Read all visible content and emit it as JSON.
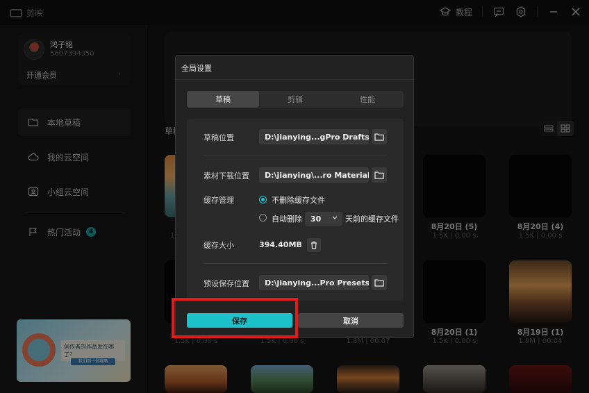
{
  "app": {
    "logo_text": "剪映",
    "help_label": "教程"
  },
  "user": {
    "name": "鸿子铭",
    "id": "5607394350",
    "vip_label": "开通会员",
    "vip_arrow": "›"
  },
  "sidebar": {
    "items": [
      {
        "label": "本地草稿",
        "icon": "folder-icon",
        "active": true
      },
      {
        "label": "我的云空间",
        "icon": "cloud-icon",
        "active": false
      },
      {
        "label": "小组云空间",
        "icon": "group-space-icon",
        "active": false
      },
      {
        "label": "热门活动",
        "icon": "flag-icon",
        "active": false,
        "badge": "4"
      }
    ],
    "banner": {
      "text": "创作者的作品发在哪了？",
      "sub": "我们到一份攻略"
    }
  },
  "main": {
    "section_label": "草稿",
    "cards": [
      {
        "title": "8月20日 (5)",
        "meta": "1.5K | 0.00 s"
      },
      {
        "title": "8月20日 (4)",
        "meta": "1.5K | 0.00 s"
      },
      {
        "title": "8月20日 (1)",
        "meta": "1.5K | 0.00 s"
      },
      {
        "title": "8月19日 (1)",
        "meta": "1.9M | 00:04"
      },
      {
        "meta": "1.5K | 0.00 s"
      },
      {
        "meta": "1.5K | 0.00 s"
      },
      {
        "meta": "1.8M | 00:07"
      }
    ],
    "partial_meta": "1(",
    "partial_meta_2": "1.5K | 0.00 s"
  },
  "dialog": {
    "title": "全局设置",
    "tabs": [
      {
        "label": "草稿",
        "active": true
      },
      {
        "label": "剪辑",
        "active": false
      },
      {
        "label": "性能",
        "active": false
      }
    ],
    "draft_location": {
      "label": "草稿位置",
      "value": "D:\\jianying...gPro Drafts"
    },
    "download_location": {
      "label": "素材下载位置",
      "value": "D:\\jianying\\...ro Materials"
    },
    "cache": {
      "label": "缓存管理",
      "option_keep": "不删除缓存文件",
      "option_auto": "自动删除",
      "days_value": "30",
      "days_suffix": "天前的缓存文件",
      "selected": "keep"
    },
    "cache_size": {
      "label": "缓存大小",
      "value": "394.40MB"
    },
    "preset_location": {
      "label": "预设保存位置",
      "value": "D:\\jianying...Pro Presets"
    },
    "save_label": "保存",
    "cancel_label": "取消"
  },
  "colors": {
    "accent": "#1cc1c9",
    "highlight": "#e21b1b",
    "badge": "#1aa3a8"
  }
}
